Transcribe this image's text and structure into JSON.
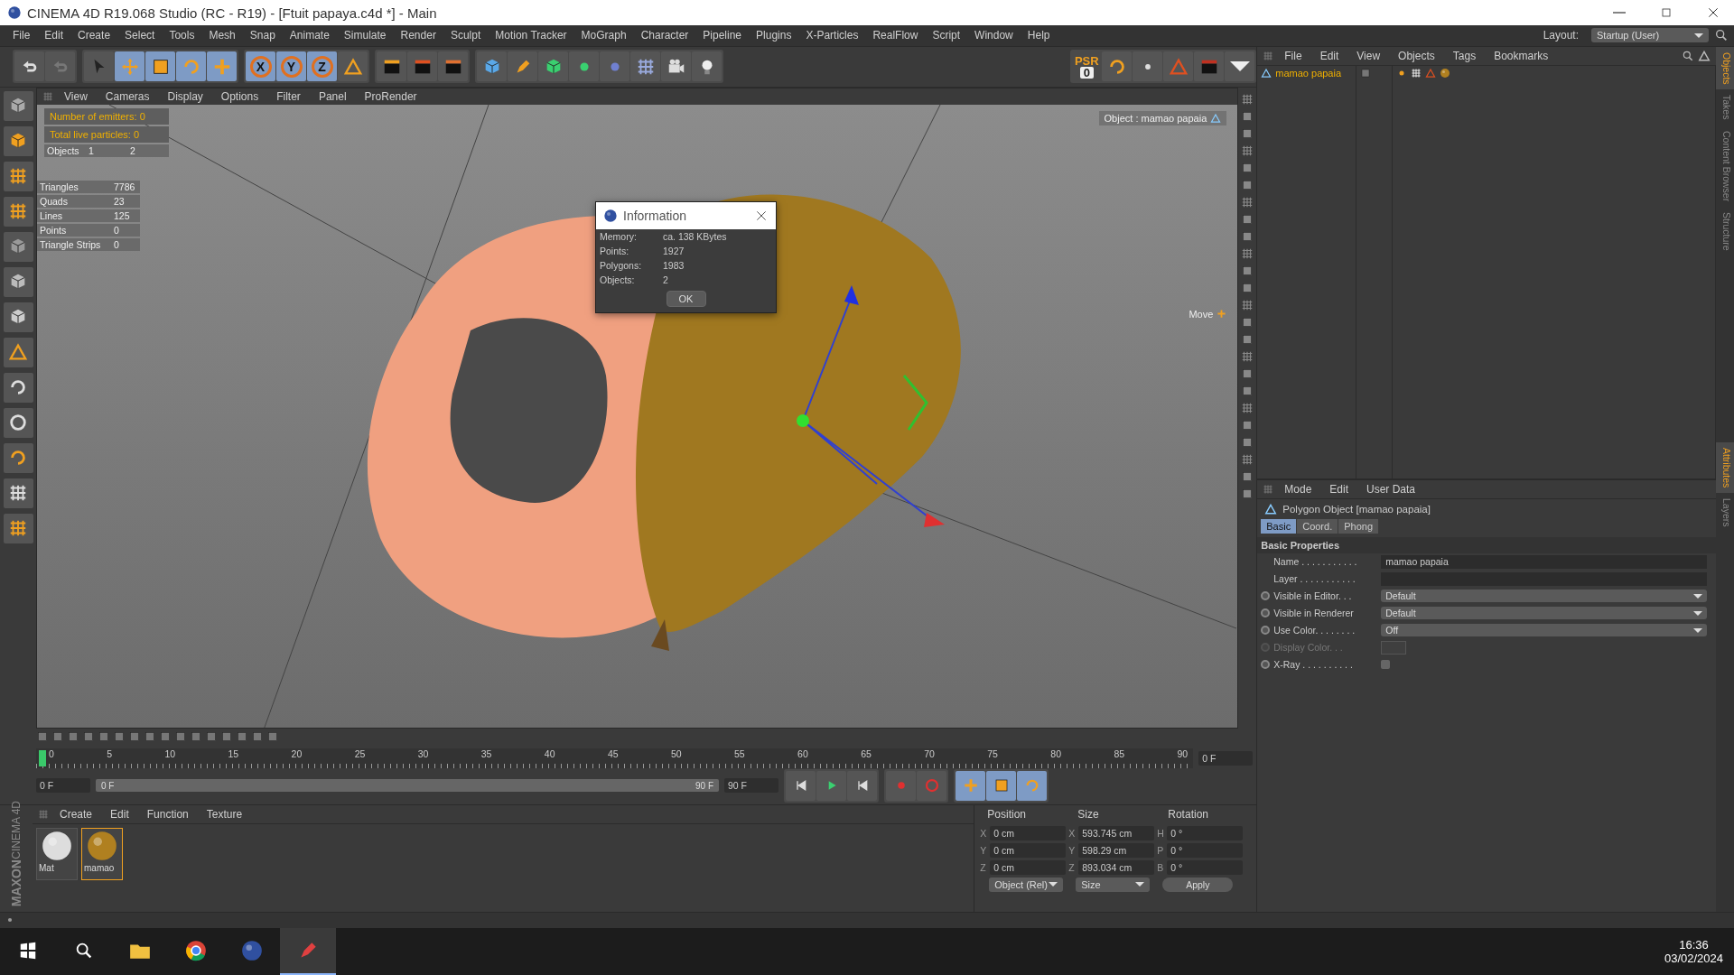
{
  "window": {
    "title": "CINEMA 4D R19.068 Studio (RC - R19) - [Ftuit papaya.c4d *] - Main"
  },
  "menu_bar": [
    "File",
    "Edit",
    "Create",
    "Select",
    "Tools",
    "Mesh",
    "Snap",
    "Animate",
    "Simulate",
    "Render",
    "Sculpt",
    "Motion Tracker",
    "MoGraph",
    "Character",
    "Pipeline",
    "Plugins",
    "X-Particles",
    "RealFlow",
    "Script",
    "Window",
    "Help"
  ],
  "layout": {
    "label": "Layout:",
    "value": "Startup (User)"
  },
  "toolbar": {
    "axis_buttons": [
      {
        "label": "X",
        "selected": true
      },
      {
        "label": "Y",
        "selected": true
      },
      {
        "label": "Z",
        "selected": true
      }
    ],
    "psr": {
      "label": "PSR",
      "value": "0"
    }
  },
  "viewport": {
    "menu": [
      "View",
      "Cameras",
      "Display",
      "Options",
      "Filter",
      "Panel",
      "ProRender"
    ],
    "hud_particles": [
      "Number of emitters: 0",
      "Total live particles: 0"
    ],
    "hud_objects": {
      "label": "Objects",
      "values": [
        "1",
        "2"
      ]
    },
    "hud_stats": [
      {
        "label": "Triangles",
        "value": "7786"
      },
      {
        "label": "Quads",
        "value": "23"
      },
      {
        "label": "Lines",
        "value": "125"
      },
      {
        "label": "Points",
        "value": "0"
      },
      {
        "label": "Triangle Strips",
        "value": "0"
      }
    ],
    "object_label": "Object : mamao papaia",
    "tool_label": "Move"
  },
  "info_dialog": {
    "title": "Information",
    "rows": [
      {
        "label": "Memory:",
        "value": "ca. 138 KBytes"
      },
      {
        "label": "Points:",
        "value": "1927"
      },
      {
        "label": "Polygons:",
        "value": "1983"
      },
      {
        "label": "Objects:",
        "value": "2"
      }
    ],
    "button": "OK"
  },
  "object_manager": {
    "menu": [
      "File",
      "Edit",
      "View",
      "Objects",
      "Tags",
      "Bookmarks"
    ],
    "objects": [
      {
        "name": "mamao papaia",
        "selected": true
      }
    ]
  },
  "attributes": {
    "menu": [
      "Mode",
      "Edit",
      "User Data"
    ],
    "object_title": "Polygon Object [mamao papaia]",
    "tabs": [
      {
        "label": "Basic",
        "selected": true
      },
      {
        "label": "Coord.",
        "selected": false
      },
      {
        "label": "Phong",
        "selected": false
      }
    ],
    "section": "Basic Properties",
    "properties": [
      {
        "kind": "text",
        "label": "Name . . . . . . . . . . .",
        "value": "mamao papaia",
        "disabled": false
      },
      {
        "kind": "link",
        "label": "Layer . . . . . . . . . . .",
        "disabled": false
      },
      {
        "kind": "dropdown",
        "label": "Visible in Editor. . .",
        "value": "Default",
        "disabled": false,
        "keyframed": false
      },
      {
        "kind": "dropdown",
        "label": "Visible in Renderer",
        "value": "Default",
        "disabled": false,
        "keyframed": false
      },
      {
        "kind": "dropdown",
        "label": "Use Color. . . . . . . .",
        "value": "Off",
        "disabled": false,
        "keyframed": false
      },
      {
        "kind": "color",
        "label": "Display Color. . .",
        "disabled": true,
        "keyframed": false
      },
      {
        "kind": "checkbox",
        "label": "X-Ray . . . . . . . . . .",
        "checked": false,
        "disabled": false,
        "keyframed": false
      }
    ]
  },
  "side_tabs_top": [
    {
      "label": "Objects",
      "selected": true
    },
    {
      "label": "Takes",
      "selected": false
    },
    {
      "label": "Content Browser",
      "selected": false
    },
    {
      "label": "Structure",
      "selected": false
    }
  ],
  "side_tabs_bottom": [
    {
      "label": "Attributes",
      "selected": true
    },
    {
      "label": "Layers",
      "selected": false
    }
  ],
  "timeline": {
    "ruler": [
      "0",
      "5",
      "10",
      "15",
      "20",
      "25",
      "30",
      "35",
      "40",
      "45",
      "50",
      "55",
      "60",
      "65",
      "70",
      "75",
      "80",
      "85",
      "90"
    ],
    "current_frame": "0 F",
    "start": "0 F",
    "range": {
      "start": "0 F",
      "end": "90 F",
      "level": 1
    },
    "end": "90 F"
  },
  "material_manager": {
    "menu": [
      "Create",
      "Edit",
      "Function",
      "Texture"
    ],
    "materials": [
      {
        "name": "Mat",
        "selected": false
      },
      {
        "name": "mamao",
        "selected": true
      }
    ]
  },
  "coordinates": {
    "headers": [
      "Position",
      "Size",
      "Rotation"
    ],
    "rows": [
      {
        "axis": "X",
        "position": "0 cm",
        "size_axis": "X",
        "size": "593.745 cm",
        "rot_axis": "H",
        "rotation": "0 °"
      },
      {
        "axis": "Y",
        "position": "0 cm",
        "size_axis": "Y",
        "size": "598.29 cm",
        "rot_axis": "P",
        "rotation": "0 °"
      },
      {
        "axis": "Z",
        "position": "0 cm",
        "size_axis": "Z",
        "size": "893.034 cm",
        "rot_axis": "B",
        "rotation": "0 °"
      }
    ],
    "mode": "Object (Rel)",
    "size_mode": "Size",
    "apply": "Apply"
  },
  "brand": [
    "MAXON",
    "CINEMA 4D"
  ],
  "taskbar": {
    "time": "16:36",
    "date": "03/02/2024"
  }
}
